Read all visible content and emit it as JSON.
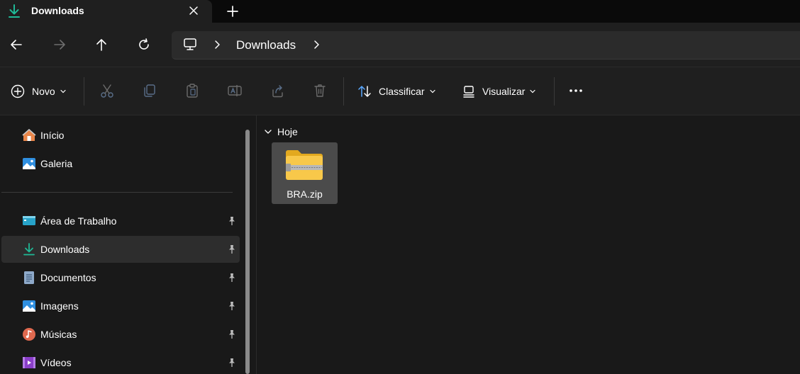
{
  "tab": {
    "title": "Downloads"
  },
  "address": {
    "crumbs": [
      "Downloads"
    ]
  },
  "toolbar": {
    "new_label": "Novo",
    "sort_label": "Classificar",
    "view_label": "Visualizar"
  },
  "sidebar": {
    "quick": [
      {
        "label": "Início",
        "icon": "home-icon"
      },
      {
        "label": "Galeria",
        "icon": "gallery-icon"
      }
    ],
    "pinned": [
      {
        "label": "Área de Trabalho",
        "icon": "desktop-icon",
        "pinned": true
      },
      {
        "label": "Downloads",
        "icon": "download-icon",
        "pinned": true,
        "selected": true
      },
      {
        "label": "Documentos",
        "icon": "document-icon",
        "pinned": true
      },
      {
        "label": "Imagens",
        "icon": "pictures-icon",
        "pinned": true
      },
      {
        "label": "Músicas",
        "icon": "music-icon",
        "pinned": true
      },
      {
        "label": "Vídeos",
        "icon": "video-icon",
        "pinned": true
      }
    ]
  },
  "content": {
    "group_title": "Hoje",
    "files": [
      {
        "name": "BRA.zip",
        "icon": "zip-folder-icon"
      }
    ]
  },
  "colors": {
    "accent": "#1fb996",
    "folder": "#f5c242",
    "background": "#191919",
    "selected": "#2d2d2d"
  }
}
